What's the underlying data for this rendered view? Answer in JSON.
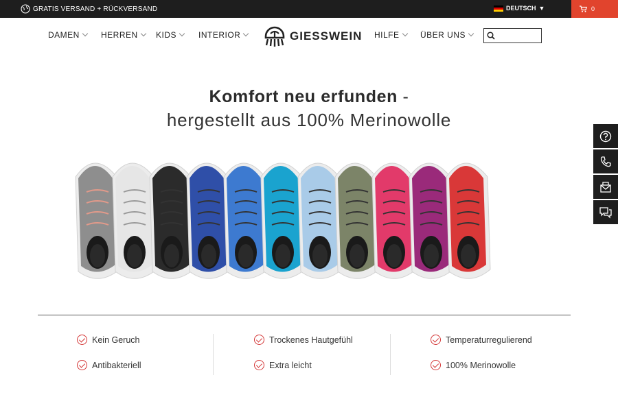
{
  "topbar": {
    "shipping": "GRATIS VERSAND + RÜCKVERSAND",
    "language": "DEUTSCH",
    "cart_count": "0"
  },
  "nav": {
    "left": [
      "DAMEN",
      "HERREN",
      "KIDS",
      "INTERIOR"
    ],
    "logo": "GIESSWEIN",
    "right": [
      "HILFE",
      "ÜBER UNS"
    ],
    "search_placeholder": ""
  },
  "hero": {
    "title_bold": "Komfort neu erfunden",
    "title_dash": " -",
    "subtitle": "hergestellt aus 100% Merinowolle",
    "shoe_colors": [
      "#8e8e8e",
      "#e6e6e6",
      "#2b2b2b",
      "#2f4fa8",
      "#3d7ad0",
      "#1aa3cf",
      "#a9cbe8",
      "#7c8468",
      "#e23a6a",
      "#9a2a7a",
      "#d93838"
    ]
  },
  "features": [
    [
      "Kein Geruch",
      "Antibakteriell"
    ],
    [
      "Trockenes Hautgefühl",
      "Extra leicht"
    ],
    [
      "Temperaturregulierend",
      "100% Merinowolle"
    ]
  ],
  "colors": {
    "topbar": "#1e1e1e",
    "accent": "#e1442d",
    "check": "#d43636"
  },
  "side_icons": [
    "help-icon",
    "phone-icon",
    "mail-icon",
    "chat-icon"
  ]
}
